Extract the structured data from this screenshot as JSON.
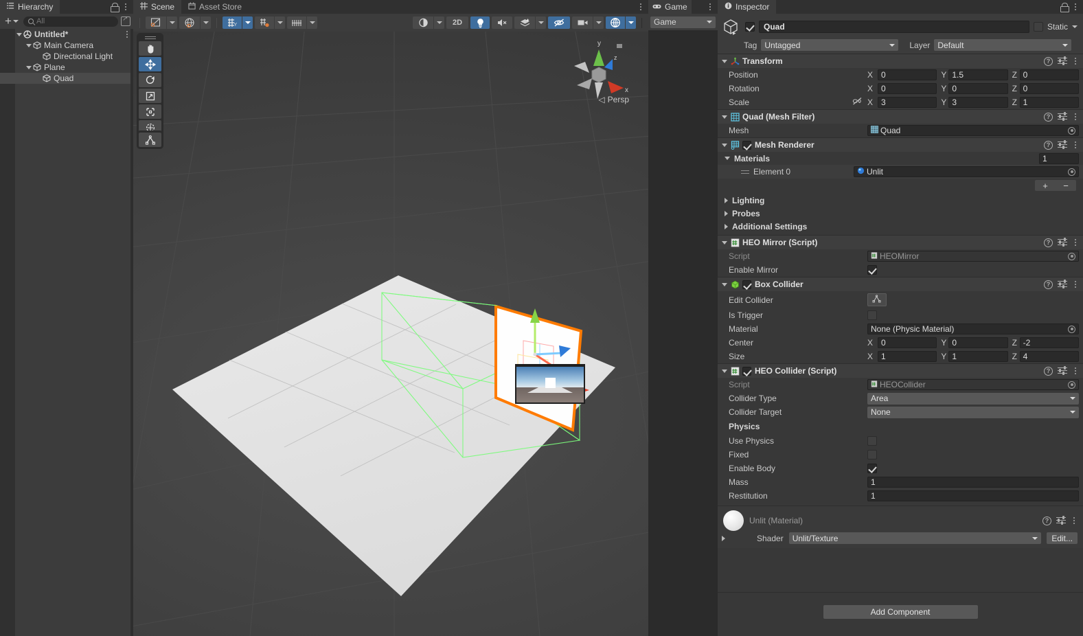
{
  "hierarchy": {
    "tab_label": "Hierarchy",
    "tab_icon": "hierarchy-icon",
    "add_label": "+",
    "search": {
      "value": "",
      "placeholder": "All"
    },
    "items": [
      {
        "label": "Untitled*",
        "icon": "unity-scene-icon",
        "depth": 0,
        "expanded": true,
        "selected": false
      },
      {
        "label": "Main Camera",
        "icon": "gameobject-icon",
        "depth": 1,
        "expanded": true,
        "selected": false
      },
      {
        "label": "Directional Light",
        "icon": "gameobject-icon",
        "depth": 2,
        "expanded": false,
        "selected": false
      },
      {
        "label": "Plane",
        "icon": "gameobject-icon",
        "depth": 1,
        "expanded": true,
        "selected": false
      },
      {
        "label": "Quad",
        "icon": "gameobject-icon",
        "depth": 2,
        "expanded": false,
        "selected": true
      }
    ]
  },
  "scene": {
    "tabs": [
      {
        "label": "Scene",
        "icon": "scene-icon",
        "active": true
      },
      {
        "label": "Asset Store",
        "icon": "asset-store-icon",
        "active": false
      }
    ],
    "toolbar": {
      "draw_mode_label": "",
      "shading_label": "",
      "twod_label": "2D",
      "lighting_label": "",
      "audio_label": "",
      "fx_label": "",
      "visibility_label": "",
      "camera_label": "",
      "gizmos_label": ""
    },
    "tools": [
      {
        "name": "hand-tool",
        "active": false
      },
      {
        "name": "move-tool",
        "active": true
      },
      {
        "name": "rotate-tool",
        "active": false
      },
      {
        "name": "scale-tool",
        "active": false
      },
      {
        "name": "rect-tool",
        "active": false
      },
      {
        "name": "transform-tool",
        "active": false
      }
    ],
    "custom_tool": {
      "name": "custom-editor-tool",
      "active": false
    },
    "gizmo": {
      "axis_x": "x",
      "axis_y": "y",
      "axis_z": "z",
      "perspective_label": "Persp"
    }
  },
  "game": {
    "tab_label": "Game",
    "tab_icon": "game-icon",
    "display_dropdown": "Game"
  },
  "inspector": {
    "tab_label": "Inspector",
    "tab_icon": "inspector-icon",
    "gameobject": {
      "name": "Quad",
      "enabled": true,
      "static_label": "Static",
      "static_checked": false,
      "tag_label": "Tag",
      "tag_value": "Untagged",
      "layer_label": "Layer",
      "layer_value": "Default"
    },
    "components": [
      {
        "title": "Transform",
        "icon": "transform-icon",
        "expanded": true,
        "has_enable_toggle": false,
        "rows": [
          {
            "type": "vector3",
            "label": "Position",
            "x": "0",
            "y": "1.5",
            "z": "0"
          },
          {
            "type": "vector3",
            "label": "Rotation",
            "x": "0",
            "y": "0",
            "z": "0"
          },
          {
            "type": "vector3",
            "label": "Scale",
            "x": "3",
            "y": "3",
            "z": "1",
            "link_icon": "constrain-proportions-off-icon"
          }
        ]
      },
      {
        "title": "Quad  (Mesh Filter)",
        "icon": "mesh-filter-icon",
        "expanded": true,
        "has_enable_toggle": false,
        "rows": [
          {
            "type": "object",
            "label": "Mesh",
            "value": "Quad",
            "value_icon": "mesh-icon"
          }
        ]
      },
      {
        "title": "Mesh Renderer",
        "icon": "mesh-renderer-icon",
        "expanded": true,
        "has_enable_toggle": true,
        "enabled": true,
        "materials": {
          "label": "Materials",
          "count": "1",
          "elements": [
            {
              "label": "Element 0",
              "value": "Unlit",
              "value_icon": "material-icon"
            }
          ],
          "add_label": "+",
          "remove_label": "−"
        },
        "foldouts": [
          {
            "label": "Lighting"
          },
          {
            "label": "Probes"
          },
          {
            "label": "Additional Settings"
          }
        ]
      },
      {
        "title": "HEO Mirror (Script)",
        "icon": "script-icon",
        "expanded": true,
        "has_enable_toggle": false,
        "rows": [
          {
            "type": "object",
            "label": "Script",
            "value": "HEOMirror",
            "value_icon": "cs-script-icon",
            "disabled": true
          },
          {
            "type": "checkbox",
            "label": "Enable Mirror",
            "checked": true
          }
        ]
      },
      {
        "title": "Box Collider",
        "icon": "box-collider-icon",
        "expanded": true,
        "has_enable_toggle": true,
        "enabled": true,
        "rows": [
          {
            "type": "button",
            "label": "Edit Collider",
            "button_icon": "edit-collider-icon"
          },
          {
            "type": "checkbox",
            "label": "Is Trigger",
            "checked": false
          },
          {
            "type": "object",
            "label": "Material",
            "value": "None (Physic Material)"
          },
          {
            "type": "vector3",
            "label": "Center",
            "x": "0",
            "y": "0",
            "z": "-2"
          },
          {
            "type": "vector3",
            "label": "Size",
            "x": "1",
            "y": "1",
            "z": "4"
          }
        ]
      },
      {
        "title": "HEO Collider (Script)",
        "icon": "script-icon",
        "expanded": true,
        "has_enable_toggle": true,
        "enabled": true,
        "rows": [
          {
            "type": "object",
            "label": "Script",
            "value": "HEOCollider",
            "value_icon": "cs-script-icon",
            "disabled": true
          },
          {
            "type": "popup",
            "label": "Collider Type",
            "value": "Area"
          },
          {
            "type": "popup",
            "label": "Collider Target",
            "value": "None"
          },
          {
            "type": "header",
            "label": "Physics"
          },
          {
            "type": "checkbox",
            "label": "Use Physics",
            "checked": false
          },
          {
            "type": "checkbox",
            "label": "Fixed",
            "checked": false
          },
          {
            "type": "checkbox",
            "label": "Enable Body",
            "checked": true
          },
          {
            "type": "text",
            "label": "Mass",
            "value": "1"
          },
          {
            "type": "text",
            "label": "Restitution",
            "value": "1"
          }
        ]
      }
    ],
    "material_preview": {
      "title": "Unlit (Material)",
      "shader_label": "Shader",
      "shader_value": "Unlit/Texture",
      "edit_label": "Edit..."
    },
    "add_component_label": "Add Component"
  },
  "colors": {
    "accent_blue": "#3f6e9e",
    "selection_orange": "#ff7b00",
    "collider_green": "#7cfc7c",
    "panel_bg": "#383838",
    "header_bg": "#3e3e3e",
    "field_bg": "#2a2a2a"
  }
}
